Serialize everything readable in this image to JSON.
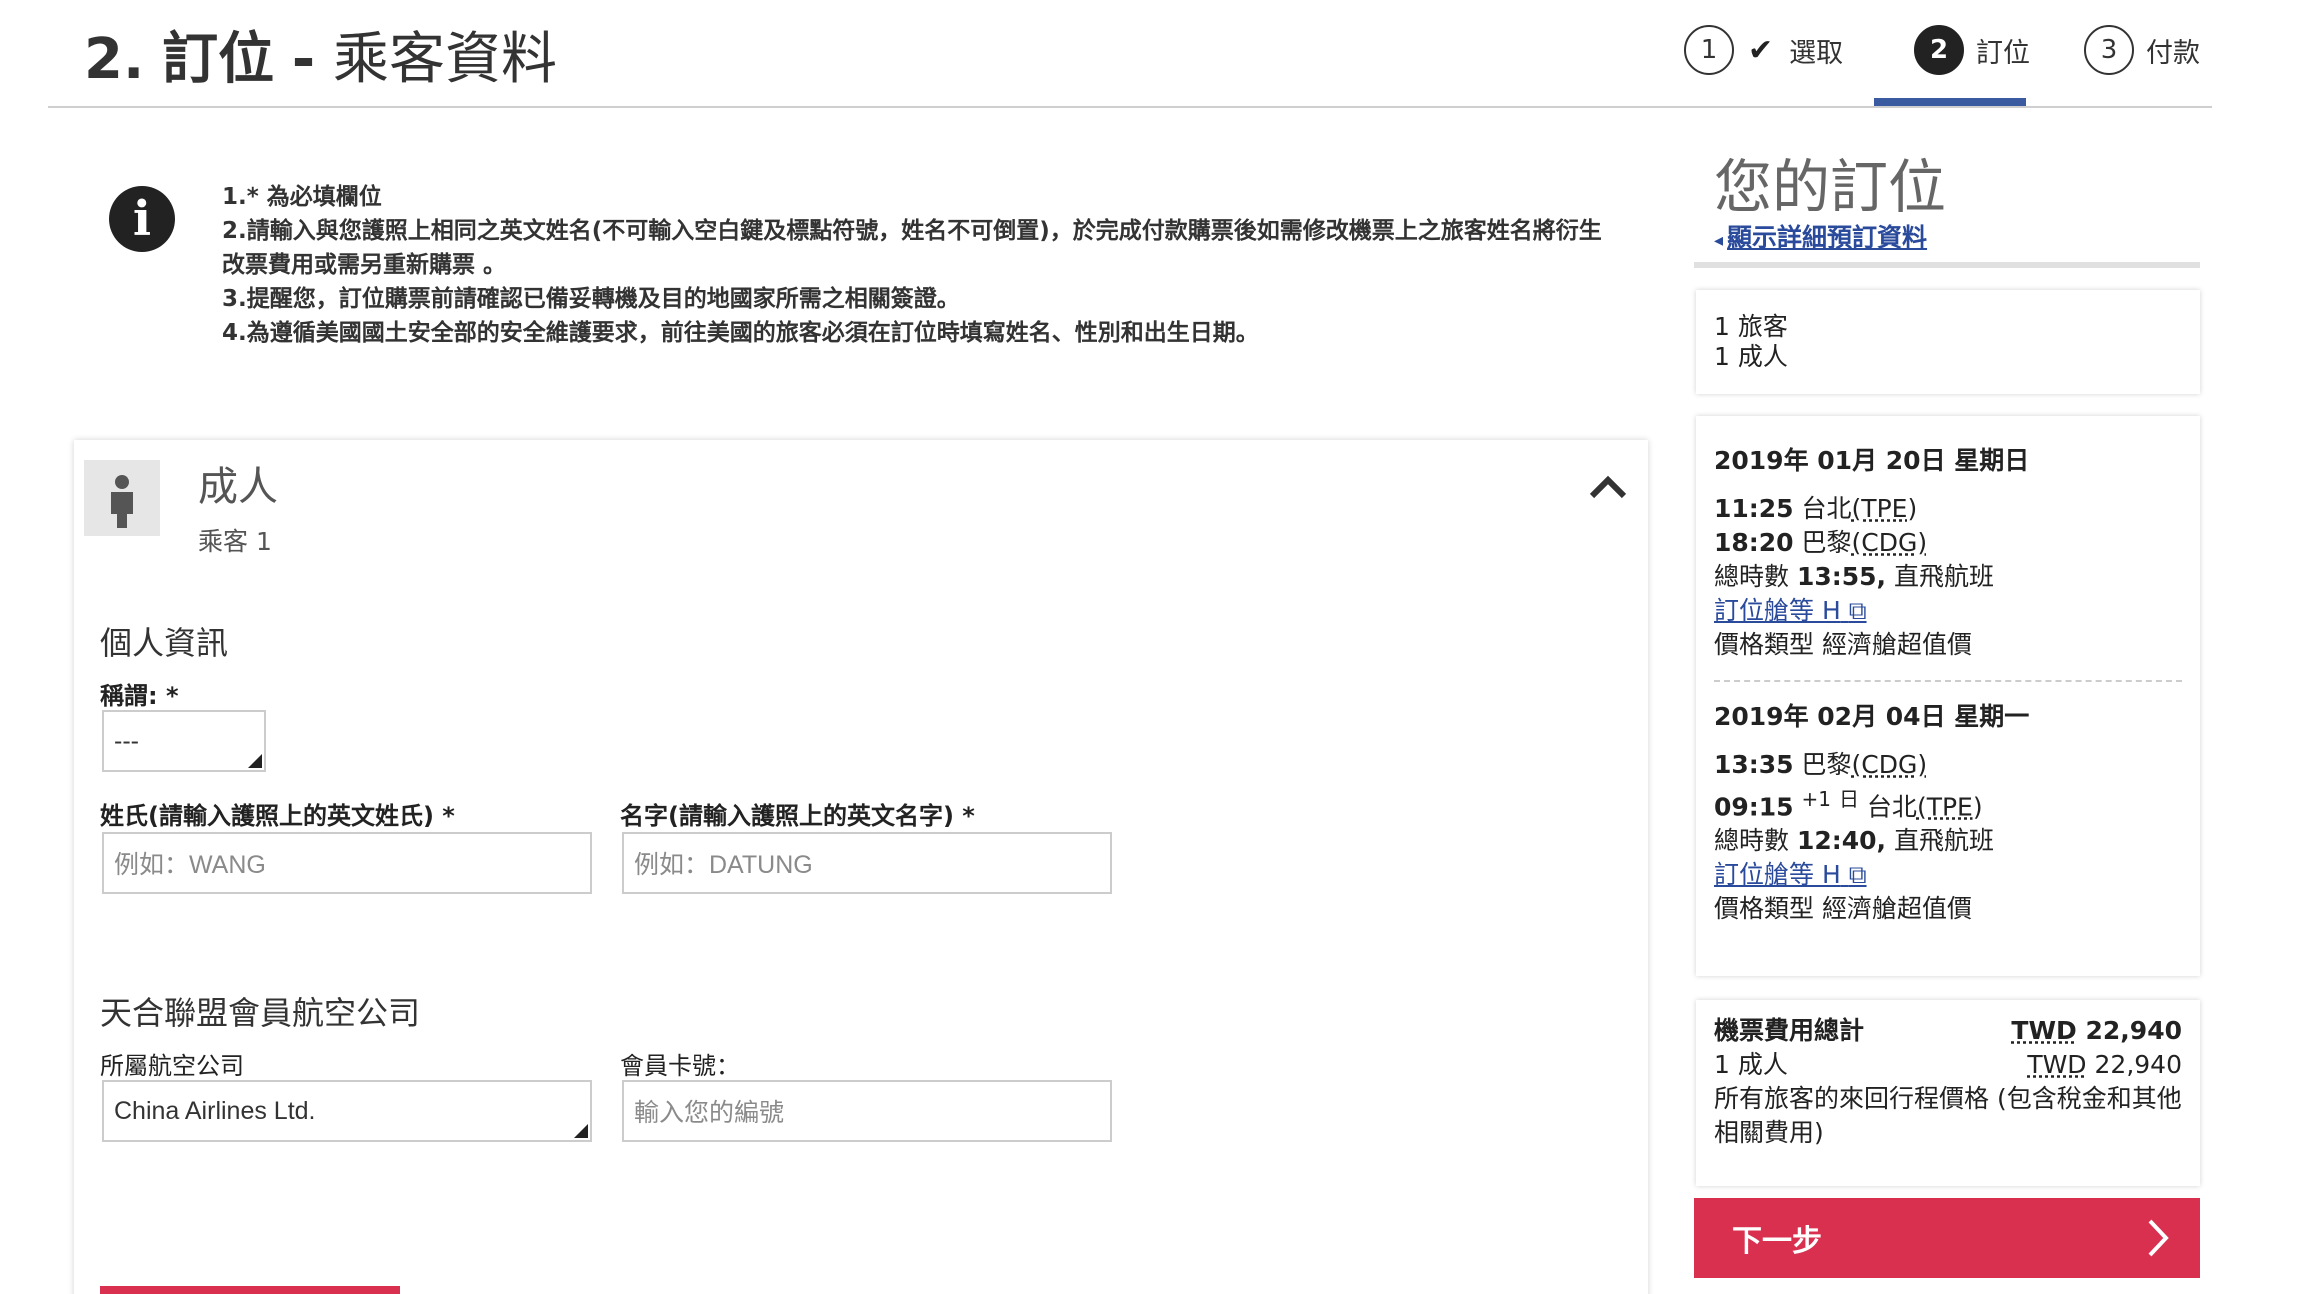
{
  "header": {
    "step_number": "2.",
    "title_main": "訂位",
    "title_sep": "-",
    "title_sub": "乘客資料"
  },
  "steps": [
    {
      "num": "1",
      "label": "選取",
      "state": "done"
    },
    {
      "num": "2",
      "label": "訂位",
      "state": "active"
    },
    {
      "num": "3",
      "label": "付款",
      "state": "pending"
    }
  ],
  "notes": [
    "1.* 為必填欄位",
    "2.請輸入與您護照上相同之英文姓名(不可輸入空白鍵及標點符號，姓名不可倒置)，於完成付款購票後如需修改機票上之旅客姓名將衍生改票費用或需另重新購票 。",
    "3.提醒您，訂位購票前請確認已備妥轉機及目的地國家所需之相關簽證。",
    "4.為遵循美國國土安全部的安全維護要求，前往美國的旅客必須在訂位時填寫姓名、性別和出生日期。"
  ],
  "passenger": {
    "title": "成人",
    "subtitle": "乘客 1",
    "personal_heading": "個人資訊",
    "salutation_label": "稱謂: *",
    "salutation_value": "---",
    "lastname_label": "姓氏(請輸入護照上的英文姓氏) *",
    "lastname_placeholder": "例如：WANG",
    "firstname_label": "名字(請輸入護照上的英文名字) *",
    "firstname_placeholder": "例如：DATUNG",
    "alliance_heading": "天合聯盟會員航空公司",
    "airline_label": "所屬航空公司",
    "airline_value": "China Airlines Ltd.",
    "member_label": "會員卡號：",
    "member_placeholder": "輸入您的編號"
  },
  "sidebar": {
    "title": "您的訂位",
    "details_link": "顯示詳細預訂資料",
    "travellers_count": "1 旅客",
    "travellers_detail": "1 成人",
    "outbound": {
      "date": "2019年 01月 20日 星期日",
      "dep_time": "11:25",
      "dep_city": "台北",
      "dep_code": "(TPE)",
      "arr_time": "18:20",
      "arr_city": "巴黎",
      "arr_code": "(CDG)",
      "duration_label": "總時數",
      "duration": "13:55,",
      "flight_type": "直飛航班",
      "cabin_link": "訂位艙等 H",
      "fare_type": "價格類型 經濟艙超值價"
    },
    "inbound": {
      "date": "2019年 02月 04日 星期一",
      "dep_time": "13:35",
      "dep_city": "巴黎",
      "dep_code": "(CDG)",
      "arr_time": "09:15",
      "arr_day": "+1",
      "arr_day_unit": "日",
      "arr_city": "台北",
      "arr_code": "(TPE)",
      "duration_label": "總時數",
      "duration": "12:40,",
      "flight_type": "直飛航班",
      "cabin_link": "訂位艙等 H",
      "fare_type": "價格類型 經濟艙超值價"
    },
    "total_label": "機票費用總計",
    "total_currency": "TWD",
    "total_amount": "22,940",
    "adult_label": "1 成人",
    "adult_currency": "TWD",
    "adult_amount": "22,940",
    "price_note": "所有旅客的來回行程價格 (包含稅金和其他相關費用)",
    "next_label": "下一步"
  },
  "colors": {
    "accent_red": "#d9304f",
    "step_underline": "#3b5ba0",
    "link_blue": "#2a4a9b"
  }
}
